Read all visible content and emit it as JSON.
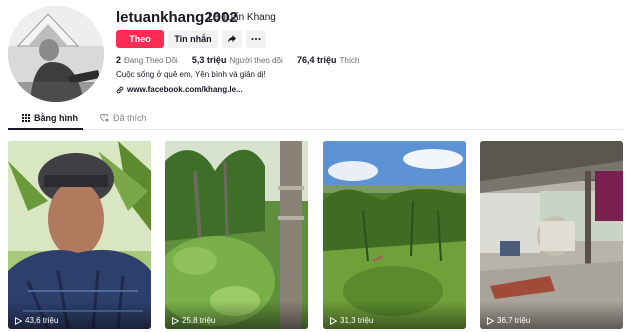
{
  "profile": {
    "username": "letuankhang2002",
    "nickname": "Lê Tuấn Khang",
    "follow_label": "Theo",
    "message_label": "Tin nhắn",
    "share_icon": "share-icon",
    "more_icon": "more-dots-icon",
    "stats": {
      "following_count": "2",
      "following_label": "Đang Theo Dõi",
      "followers_count": "5,3 triệu",
      "followers_label": "Người theo dõi",
      "likes_count": "76,4 triệu",
      "likes_label": "Thích"
    },
    "bio": "Cuộc sống ở quê em, Yên bình và giản dị!",
    "link": "www.facebook.com/khang.le..."
  },
  "tabs": [
    {
      "label": "Bằng hình",
      "icon": "grid-icon",
      "active": true
    },
    {
      "label": "Đã thích",
      "icon": "heart-lock-icon",
      "active": false
    }
  ],
  "videos": [
    {
      "views": "43,6 triệu",
      "icon": "play-icon"
    },
    {
      "views": "25,8 triệu",
      "icon": "play-icon"
    },
    {
      "views": "31,3 triệu",
      "icon": "play-icon"
    },
    {
      "views": "36,7 triệu",
      "icon": "play-icon"
    }
  ],
  "colors": {
    "accent": "#fe2c55",
    "text": "#161823",
    "muted": "#8a8b91",
    "button_bg": "#f1f1f2"
  }
}
